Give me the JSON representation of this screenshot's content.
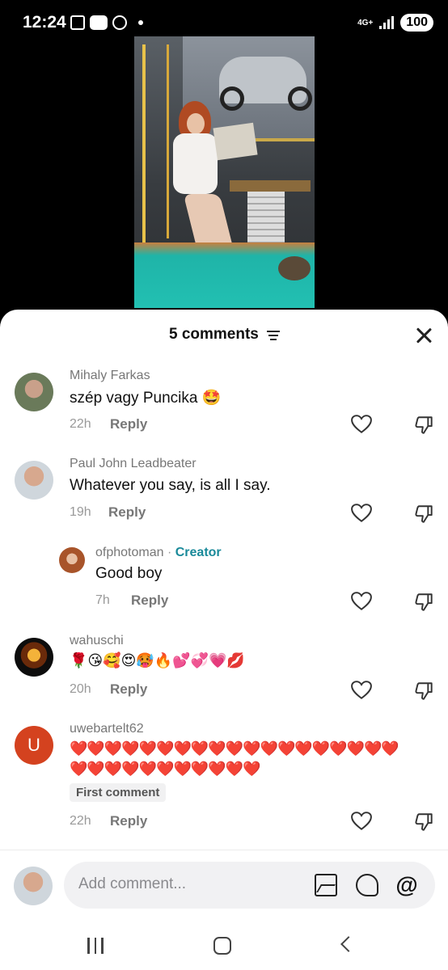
{
  "status_bar": {
    "time": "12:24",
    "network": "4G+",
    "battery": "100"
  },
  "sheet": {
    "title": "5 comments"
  },
  "comments": [
    {
      "username": "Mihaly Farkas",
      "text": "szép vagy Puncika 🤩",
      "time": "22h",
      "reply_label": "Reply"
    },
    {
      "username": "Paul John Leadbeater",
      "text": "Whatever you say, is all I say.",
      "time": "19h",
      "reply_label": "Reply"
    },
    {
      "username": "ofphotoman",
      "creator_label": "Creator",
      "text": "Good boy",
      "time": "7h",
      "reply_label": "Reply"
    },
    {
      "username": "wahuschi",
      "text": "🌹😘🥰😍🥵🔥💕💞💗💋",
      "time": "20h",
      "reply_label": "Reply"
    },
    {
      "username": "uwebartelt62",
      "avatar_letter": "U",
      "text_line1": "❤️❤️❤️❤️❤️❤️❤️❤️❤️❤️❤️❤️❤️❤️❤️❤️❤️❤️❤️",
      "text_line2": "❤️❤️❤️❤️❤️❤️❤️❤️❤️❤️❤️",
      "badge": "First comment",
      "time": "22h",
      "reply_label": "Reply"
    }
  ],
  "composer": {
    "placeholder": "Add comment...",
    "at_symbol": "@"
  },
  "colors": {
    "creator": "#1a8a9a",
    "avatar_u": "#d4421f"
  }
}
